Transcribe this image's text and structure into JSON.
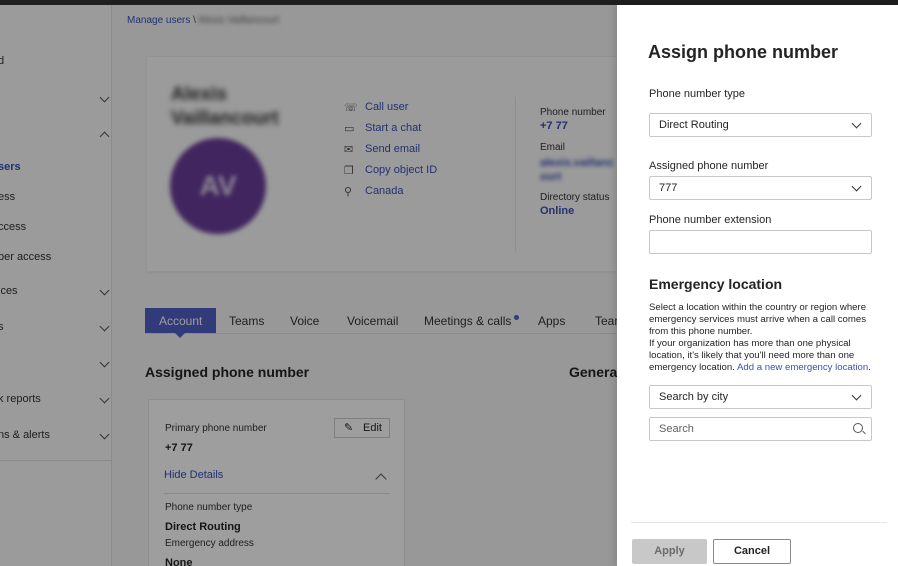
{
  "breadcrumb": {
    "root": "Manage users",
    "separator": "\\",
    "current": "Alexis Vaillancourt"
  },
  "left_nav": {
    "items": [
      {
        "label": "d",
        "chevron": "none"
      },
      {
        "label": "",
        "chevron": "down"
      },
      {
        "label": "",
        "chevron": "up"
      },
      {
        "label": "sers",
        "chevron": "none",
        "active": true
      },
      {
        "label": "ess",
        "chevron": "none"
      },
      {
        "label": "ccess",
        "chevron": "none"
      },
      {
        "label": "ber access",
        "chevron": "none"
      },
      {
        "label": "ices",
        "chevron": "down"
      },
      {
        "label": "s",
        "chevron": "down"
      },
      {
        "label": "",
        "chevron": "down"
      },
      {
        "label": "k reports",
        "chevron": "down"
      },
      {
        "label": "ns & alerts",
        "chevron": "down"
      }
    ]
  },
  "profile": {
    "name": "Alexis Vaillancourt",
    "initials": "AV",
    "avatar_color": "#6a3d9a",
    "actions": [
      {
        "icon": "phone-icon",
        "label": "Call user"
      },
      {
        "icon": "chat-icon",
        "label": "Start a chat"
      },
      {
        "icon": "mail-icon",
        "label": "Send email"
      },
      {
        "icon": "copy-icon",
        "label": "Copy object ID"
      },
      {
        "icon": "location-icon",
        "label": "Canada"
      }
    ],
    "phone_label": "Phone number",
    "phone_value": "+7 77",
    "email_label": "Email",
    "email_value": "alexis.vaillancourt",
    "status_label": "Directory status",
    "status_value": "Online"
  },
  "tabs": [
    {
      "label": "Account",
      "active": true
    },
    {
      "label": "Teams"
    },
    {
      "label": "Voice"
    },
    {
      "label": "Voicemail"
    },
    {
      "label": "Meetings & calls",
      "dot": true
    },
    {
      "label": "Apps"
    },
    {
      "label": "Team"
    }
  ],
  "assigned_section": {
    "title": "Assigned phone number",
    "general_title": "General",
    "primary_label": "Primary phone number",
    "primary_value": "+7 77",
    "edit_label": "Edit",
    "hide_details": "Hide Details",
    "type_label": "Phone number type",
    "type_value": "Direct Routing",
    "emergency_label": "Emergency address",
    "emergency_value": "None"
  },
  "panel": {
    "title": "Assign phone number",
    "type_label": "Phone number type",
    "type_value": "Direct Routing",
    "assigned_label": "Assigned phone number",
    "assigned_value": "777",
    "extension_label": "Phone number extension",
    "extension_value": "",
    "emergency_title": "Emergency location",
    "para1": "Select a location within the country or region where emergency services must arrive when a call comes from this phone number.",
    "para2": "If your organization has more than one physical location, it's likely that you'll need more than one emergency location.",
    "add_link": "Add a new emergency location",
    "search_by": "Search by city",
    "search_placeholder": "Search",
    "apply_label": "Apply",
    "cancel_label": "Cancel"
  }
}
